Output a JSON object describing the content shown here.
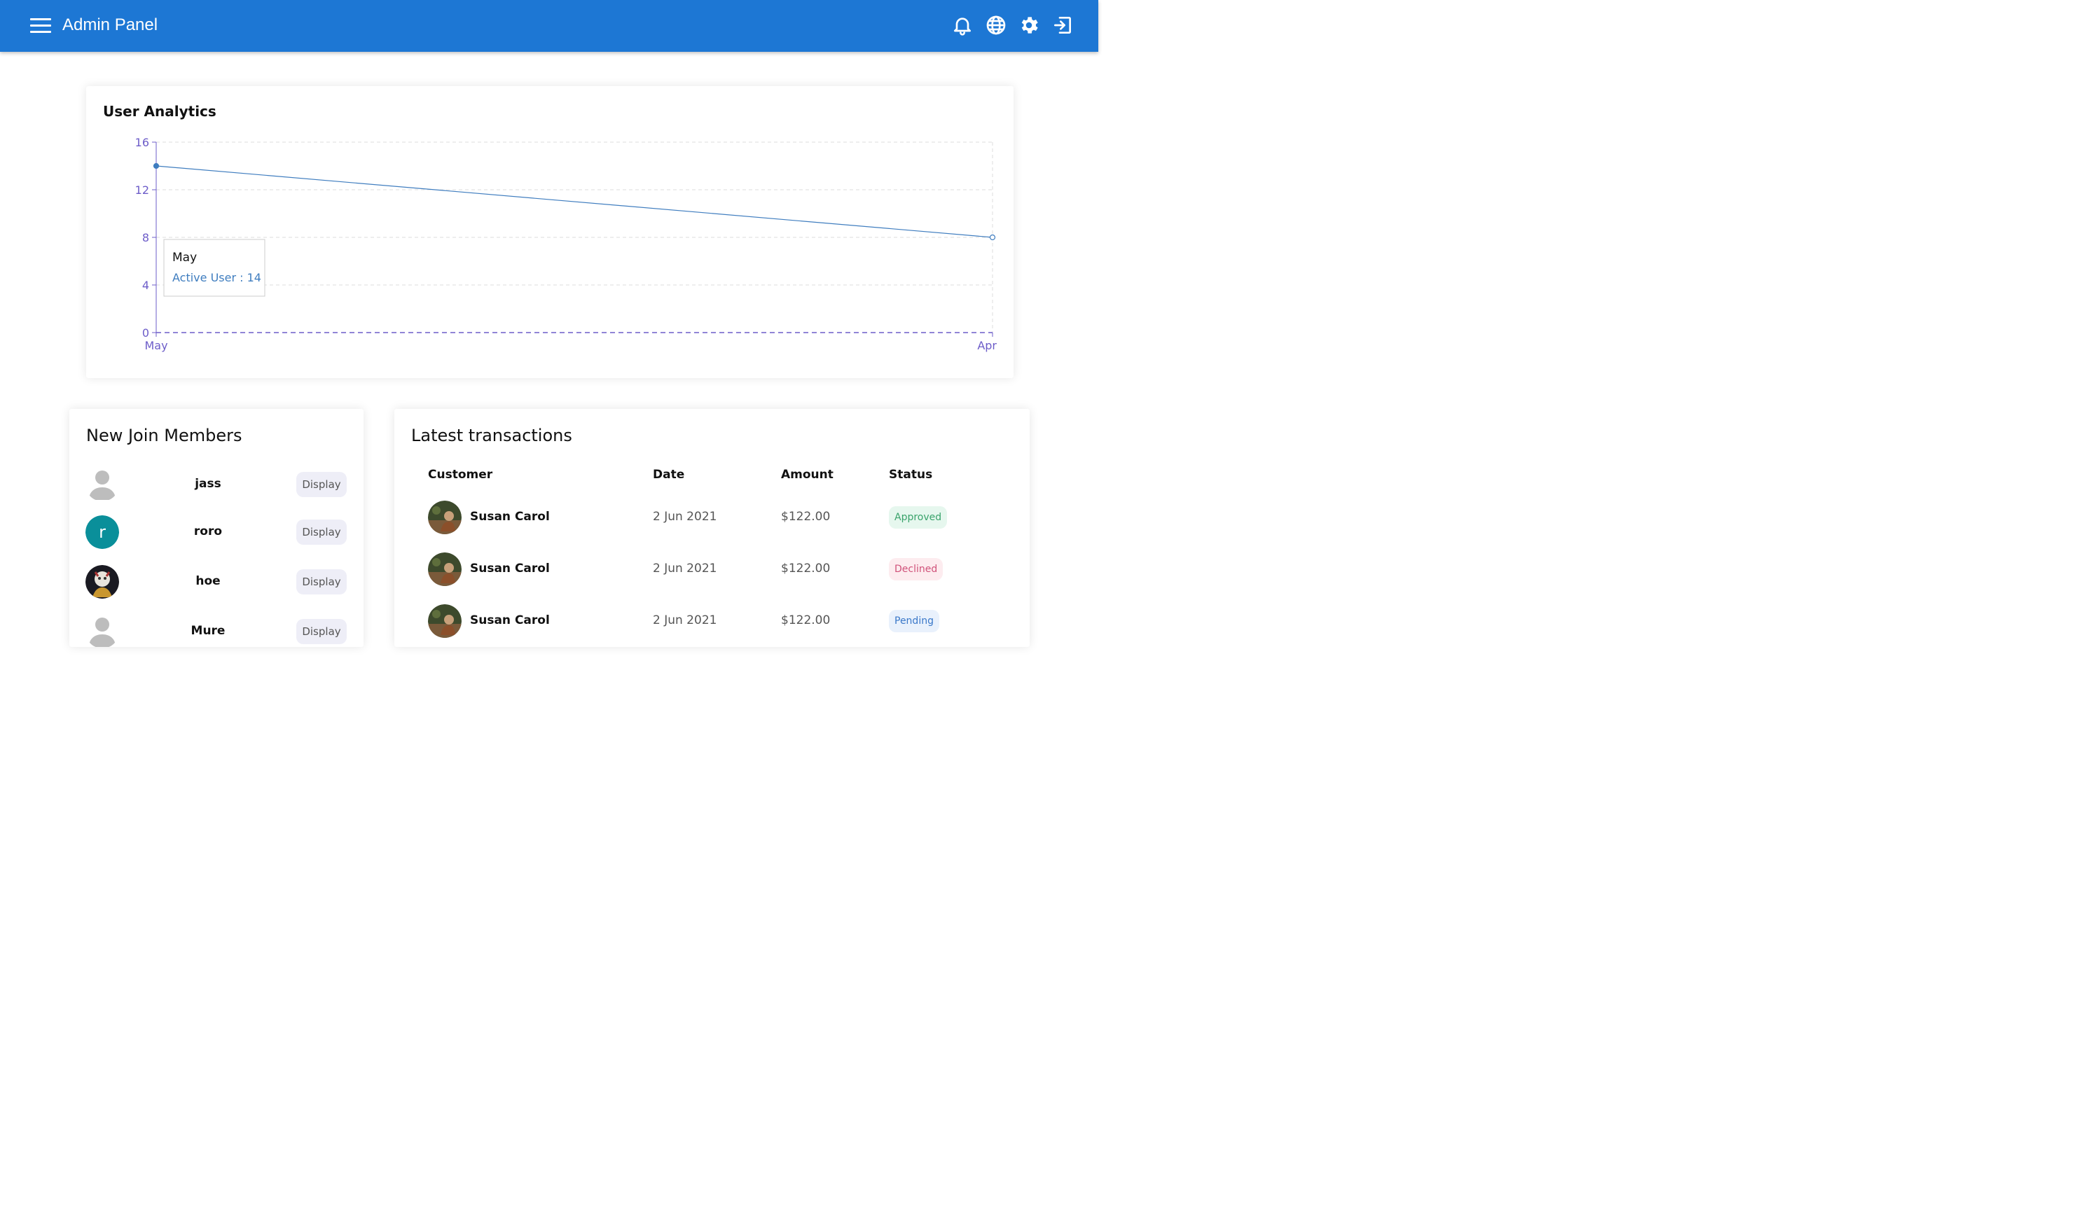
{
  "appbar": {
    "title": "Admin Panel",
    "icons": [
      "menu-icon",
      "bell-icon",
      "globe-icon",
      "gear-icon",
      "logout-icon"
    ]
  },
  "analytics": {
    "title": "User Analytics",
    "tooltip": {
      "category": "May",
      "series_label": "Active User",
      "separator": " : ",
      "value": "14"
    }
  },
  "chart_data": {
    "type": "line",
    "title": "User Analytics",
    "categories": [
      "May",
      "Apr"
    ],
    "series": [
      {
        "name": "Active User",
        "values": [
          14,
          8
        ],
        "color": "#3f7dbf"
      }
    ],
    "ylim": [
      0,
      16
    ],
    "yticks": [
      0,
      4,
      8,
      12,
      16
    ],
    "grid": true,
    "axis_color": "#6d5dc9"
  },
  "members": {
    "title": "New Join Members",
    "button_label": "Display",
    "items": [
      {
        "name": "jass",
        "avatar": "default-user-icon"
      },
      {
        "name": "roro",
        "avatar": "letter",
        "initial": "r",
        "color": "#0a8f9a"
      },
      {
        "name": "hoe",
        "avatar": "photo"
      },
      {
        "name": "Mure",
        "avatar": "default-user-icon"
      }
    ]
  },
  "transactions": {
    "title": "Latest transactions",
    "headers": {
      "customer": "Customer",
      "date": "Date",
      "amount": "Amount",
      "status": "Status"
    },
    "rows": [
      {
        "customer": "Susan Carol",
        "date": "2 Jun 2021",
        "amount": "$122.00",
        "status": "Approved"
      },
      {
        "customer": "Susan Carol",
        "date": "2 Jun 2021",
        "amount": "$122.00",
        "status": "Declined"
      },
      {
        "customer": "Susan Carol",
        "date": "2 Jun 2021",
        "amount": "$122.00",
        "status": "Pending"
      }
    ],
    "status_colors": {
      "Approved": {
        "bg": "#e6f7ee",
        "fg": "#3aa36b"
      },
      "Declined": {
        "bg": "#fdecef",
        "fg": "#d0527a"
      },
      "Pending": {
        "bg": "#e9f1fc",
        "fg": "#3a78c9"
      }
    }
  }
}
